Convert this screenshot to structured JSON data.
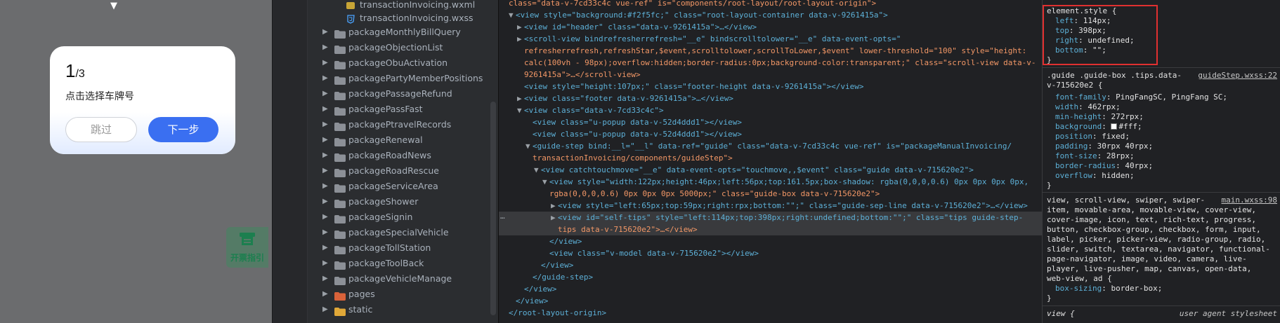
{
  "simulator": {
    "top_arrow": "▼",
    "guide": {
      "step_current": "1",
      "step_total": "/3",
      "tip": "点击选择车牌号",
      "skip_label": "跳过",
      "next_label": "下一步"
    },
    "invoice_button_label": "开票指引",
    "colors": {
      "primary": "#3a6ff1",
      "invoice": "#1c7f4f"
    }
  },
  "tree": {
    "files": [
      {
        "icon": "wxml-file-icon",
        "name": "transactionInvoicing.wxml"
      },
      {
        "icon": "wxss-file-icon",
        "name": "transactionInvoicing.wxss"
      }
    ],
    "folders": [
      "packageMonthlyBillQuery",
      "packageObjectionList",
      "packageObuActivation",
      "packagePartyMemberPositions",
      "packagePassageRefund",
      "packagePassFast",
      "packagePtravelRecords",
      "packageRenewal",
      "packageRoadNews",
      "packageRoadRescue",
      "packageServiceArea",
      "packageShower",
      "packageSignin",
      "packageSpecialVehicle",
      "packageTollStation",
      "packageToolBack",
      "packageVehicleManage",
      "pages",
      "static"
    ]
  },
  "elements": {
    "lines": [
      "class=\"data-v-7cd33c4c vue-ref\" is=\"components/root-layout/root-layout-origin\">",
      "<view style=\"background:#f2f5fc;\" class=\"root-layout-container data-v-9261415a\">",
      "<view id=\"header\" class=\"data-v-9261415a\">…</view>",
      "<scroll-view bindrefresherrefresh=\"__e\" bindscrolltolower=\"__e\" data-event-opts=\"",
      "refresherrefresh,refreshStar,$event,scrolltolower,scrollToLower,$event\" lower-threshold=\"100\" style=\"height:",
      "calc(100vh - 98px);overflow:hidden;border-radius:0px;background-color:transparent;\" class=\"scroll-view data-v-",
      "9261415a\">…</scroll-view>",
      "<view style=\"height:107px;\" class=\"footer-height data-v-9261415a\"></view>",
      "<view class=\"footer data-v-9261415a\">…</view>",
      "<view class=\"data-v-7cd33c4c\">",
      "<view class=\"u-popup data-v-52d4ddd1\"></view>",
      "<view class=\"u-popup data-v-52d4ddd1\"></view>",
      "<guide-step bind:__l=\"__l\" data-ref=\"guide\" class=\"data-v-7cd33c4c vue-ref\" is=\"packageManualInvoicing/",
      "transactionInvoicing/components/guideStep\">",
      "<view catchtouchmove=\"__e\" data-event-opts=\"touchmove,,$event\" class=\"guide data-v-715620e2\">",
      "<view style=\"width:122px;height:46px;left:56px;top:161.5px;box-shadow: rgba(0,0,0,0.6) 0px 0px 0px 0px,",
      "rgba(0,0,0,0.6) 0px 0px 0px 5000px;\" class=\"guide-box data-v-715620e2\">",
      "<view style=\"left:65px;top:59px;right:rpx;bottom:\"\";\" class=\"guide-sep-line data-v-715620e2\">…</view>",
      "<view id=\"self-tips\" style=\"left:114px;top:398px;right:undefined;bottom:\"\";\" class=\"tips guide-step-",
      "tips data-v-715620e2\">…</view>",
      "</view>",
      "<view class=\"v-model data-v-715620e2\"></view>",
      "</view>",
      "</guide-step>",
      "</view>",
      "</view>",
      "</root-layout-origin>"
    ],
    "dots": "…"
  },
  "styles": {
    "element_style": {
      "selector": "element.style {",
      "props": [
        {
          "name": "left",
          "value": "114px;"
        },
        {
          "name": "top",
          "value": "398px;"
        },
        {
          "name": "right",
          "value": "undefined;"
        },
        {
          "name": "bottom",
          "value": "\"\";"
        }
      ],
      "close": "}"
    },
    "rule2": {
      "selector_line1": ".guide .guide-box .tips.data-",
      "selector_line2": "v-715620e2 {",
      "source": "guideStep.wxss:22",
      "props": [
        {
          "name": "font-family",
          "value": "PingFangSC, PingFang SC;"
        },
        {
          "name": "width",
          "value": "462rpx;"
        },
        {
          "name": "min-height",
          "value": "272rpx;"
        },
        {
          "name": "background",
          "value": "#fff;"
        },
        {
          "name": "position",
          "value": "fixed;"
        },
        {
          "name": "padding",
          "value": "30rpx 40rpx;"
        },
        {
          "name": "font-size",
          "value": "28rpx;"
        },
        {
          "name": "border-radius",
          "value": "40rpx;"
        },
        {
          "name": "overflow",
          "value": "hidden;"
        }
      ],
      "close": "}"
    },
    "rule3": {
      "source": "main.wxss:98",
      "selector_lines": [
        "view, scroll-view, swiper, swiper-",
        "item, movable-area, movable-view, cover-view,",
        "cover-image, icon, text, rich-text, progress,",
        "button, checkbox-group, checkbox, form, input,",
        "label, picker, picker-view, radio-group, radio,",
        "slider, switch, textarea, navigator, functional-",
        "page-navigator, image, video, camera, live-",
        "player, live-pusher, map, canvas, open-data,",
        "web-view, ad {"
      ],
      "prop": {
        "name": "box-sizing",
        "value": "border-box;"
      },
      "close": "}"
    },
    "rule4": {
      "selector": "view {",
      "source": "user agent stylesheet"
    }
  }
}
